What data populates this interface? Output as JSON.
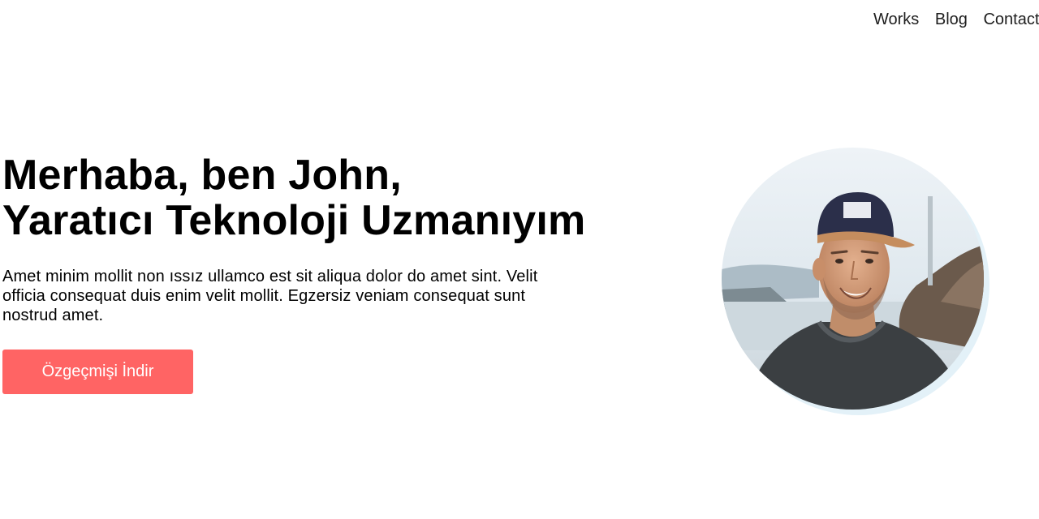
{
  "nav": {
    "items": [
      {
        "label": "Works"
      },
      {
        "label": "Blog"
      },
      {
        "label": "Contact"
      }
    ]
  },
  "hero": {
    "title_line1": "Merhaba, ben John,",
    "title_line2": "Yaratıcı Teknoloji Uzmanıyım",
    "description": "Amet minim mollit non ıssız ullamco est sit aliqua dolor do amet sint. Velit officia consequat duis enim velit mollit. Egzersiz veniam consequat sunt nostrud amet.",
    "button_label": "Özgeçmişi İndir"
  },
  "colors": {
    "accent": "#FF6464",
    "avatar_ring": "#E3F1F8"
  },
  "icons": {
    "avatar": "profile-photo"
  }
}
